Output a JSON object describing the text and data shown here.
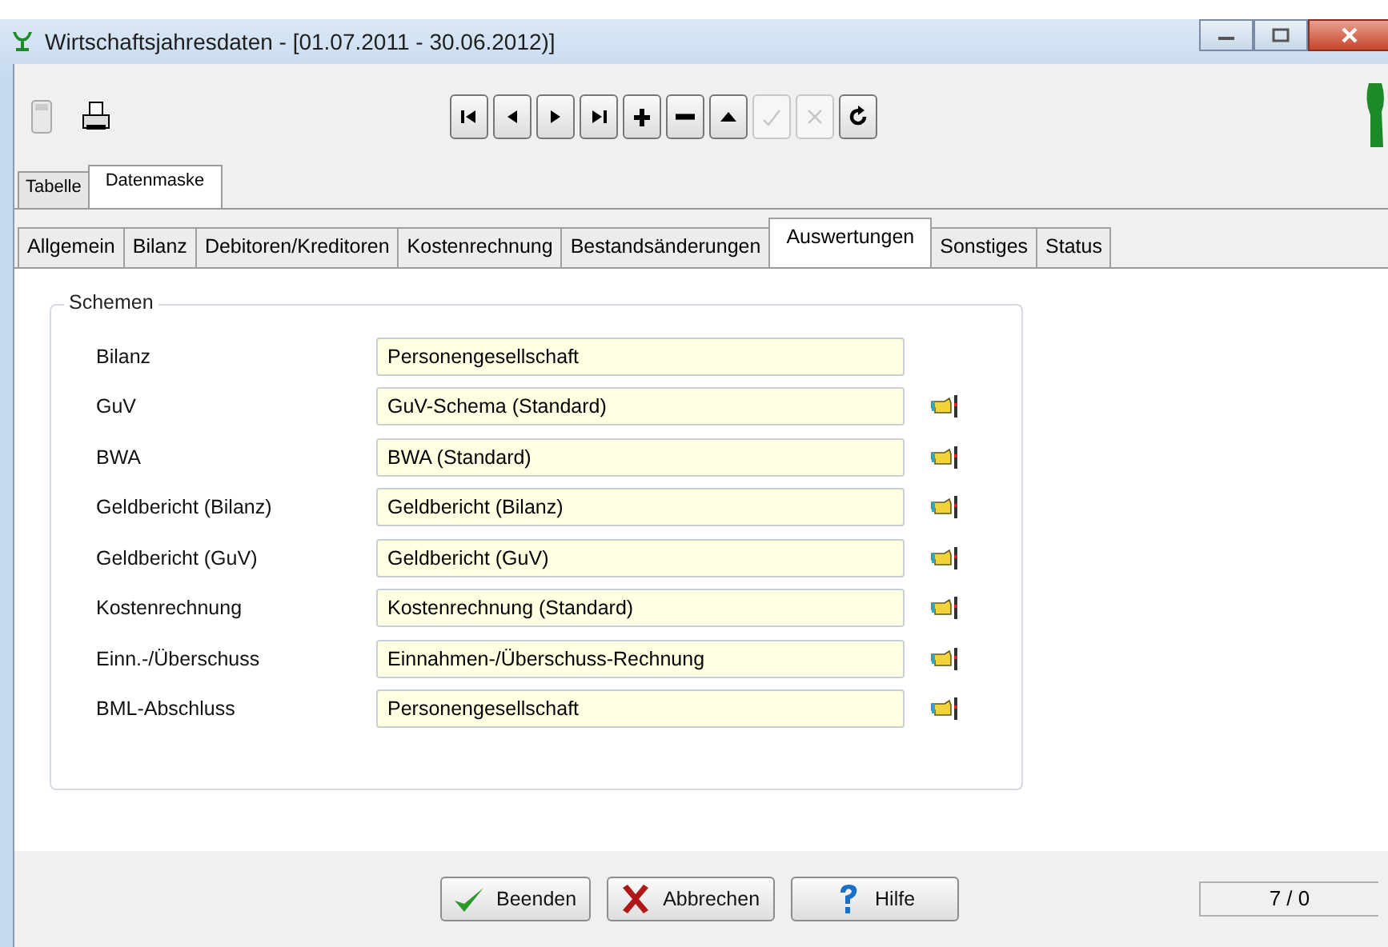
{
  "window": {
    "title": "Wirtschaftsjahresdaten - [01.07.2011 - 30.06.2012)]"
  },
  "toolbar": [
    {
      "kind": "first",
      "disabled": false
    },
    {
      "kind": "prev",
      "disabled": false
    },
    {
      "kind": "next",
      "disabled": false
    },
    {
      "kind": "last",
      "disabled": false
    },
    {
      "kind": "add",
      "disabled": false
    },
    {
      "kind": "remove",
      "disabled": false
    },
    {
      "kind": "up",
      "disabled": false
    },
    {
      "kind": "confirm",
      "disabled": true
    },
    {
      "kind": "cancel",
      "disabled": true
    },
    {
      "kind": "refresh",
      "disabled": false
    }
  ],
  "view_tabs": [
    {
      "label": "Tabelle",
      "selected": false
    },
    {
      "label": "Datenmaske",
      "selected": true
    }
  ],
  "tabs": [
    {
      "label": "Allgemein",
      "selected": false
    },
    {
      "label": "Bilanz",
      "selected": false
    },
    {
      "label": "Debitoren/Kreditoren",
      "selected": false
    },
    {
      "label": "Kostenrechnung",
      "selected": false
    },
    {
      "label": "Bestandsänderungen",
      "selected": false
    },
    {
      "label": "Auswertungen",
      "selected": true
    },
    {
      "label": "Sonstiges",
      "selected": false
    },
    {
      "label": "Status",
      "selected": false
    }
  ],
  "group": {
    "title": "Schemen",
    "rows": [
      {
        "label": "Bilanz",
        "value": "Personengesellschaft",
        "picker": false
      },
      {
        "label": "GuV",
        "value": "GuV-Schema (Standard)",
        "picker": true
      },
      {
        "label": "BWA",
        "value": "BWA (Standard)",
        "picker": true
      },
      {
        "label": "Geldbericht (Bilanz)",
        "value": "Geldbericht (Bilanz)",
        "picker": true
      },
      {
        "label": "Geldbericht (GuV)",
        "value": "Geldbericht (GuV)",
        "picker": true
      },
      {
        "label": "Kostenrechnung",
        "value": "Kostenrechnung (Standard)",
        "picker": true
      },
      {
        "label": "Einn.-/Überschuss",
        "value": "Einnahmen-/Überschuss-Rechnung",
        "picker": true
      },
      {
        "label": "BML-Abschluss",
        "value": "Personengesellschaft",
        "picker": true
      }
    ]
  },
  "buttons": [
    {
      "kind": "ok",
      "label": "Beenden"
    },
    {
      "kind": "cancel",
      "label": "Abbrechen"
    },
    {
      "kind": "help",
      "label": "Hilfe"
    }
  ],
  "status": "7 / 0"
}
